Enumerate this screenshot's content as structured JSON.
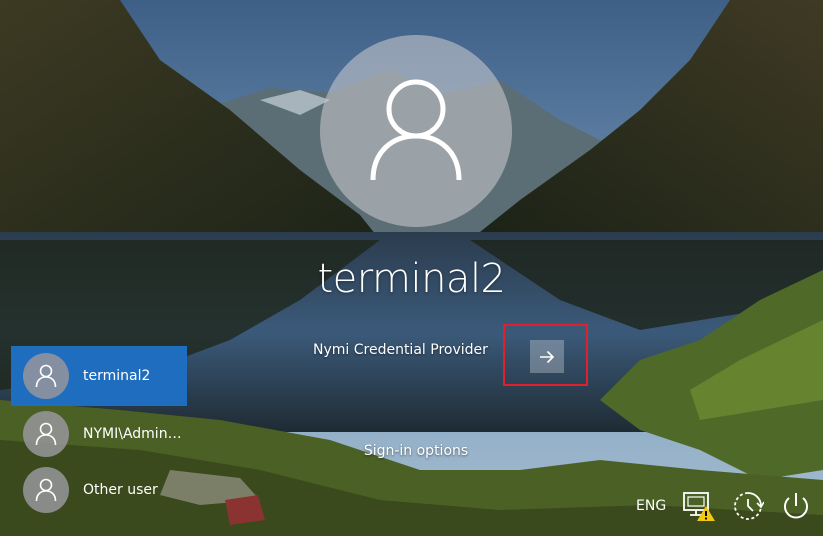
{
  "login": {
    "username": "terminal2",
    "credential_provider": "Nymi Credential Provider",
    "submit_icon": "arrow-right-icon",
    "sign_in_options": "Sign-in options"
  },
  "users": [
    {
      "name": "terminal2",
      "active": true,
      "icon": "user-icon"
    },
    {
      "name": "NYMI\\Administrator",
      "active": false,
      "icon": "user-icon"
    },
    {
      "name": "Other user",
      "active": false,
      "icon": "user-icon"
    }
  ],
  "tray": {
    "language": "ENG",
    "network_icon": "network-warning-icon",
    "ease_of_access_icon": "ease-of-access-icon",
    "power_icon": "power-icon"
  },
  "colors": {
    "active_user": "#1f6dbf",
    "highlight": "#e0202a",
    "warning": "#f2c811"
  }
}
